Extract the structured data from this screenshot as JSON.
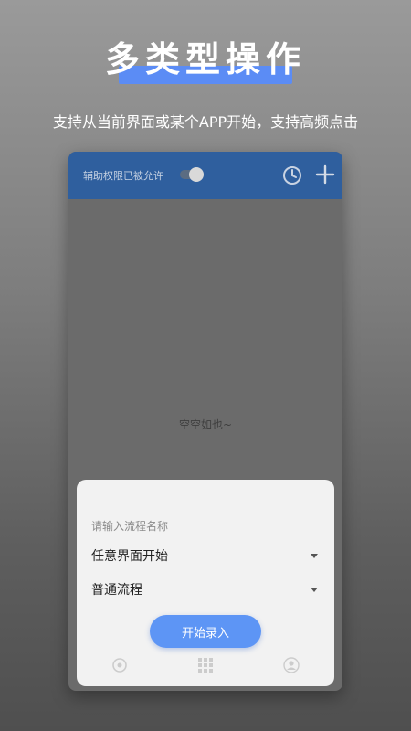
{
  "hero": {
    "title": "多类型操作",
    "subtitle": "支持从当前界面或某个APP开始，支持高频点击",
    "highlight_color": "#5b8cf5"
  },
  "appbar": {
    "accessibility_label": "辅助权限已被允许",
    "toggle_state": "on",
    "history_icon": "clock-icon",
    "add_icon": "plus-icon",
    "bg_color": "#2f5f9e"
  },
  "content": {
    "empty_text": "空空如也~"
  },
  "sheet": {
    "name_placeholder": "请输入流程名称",
    "start_select": "任意界面开始",
    "type_select": "普通流程",
    "start_button": "开始录入",
    "button_color": "#5d95f5"
  }
}
